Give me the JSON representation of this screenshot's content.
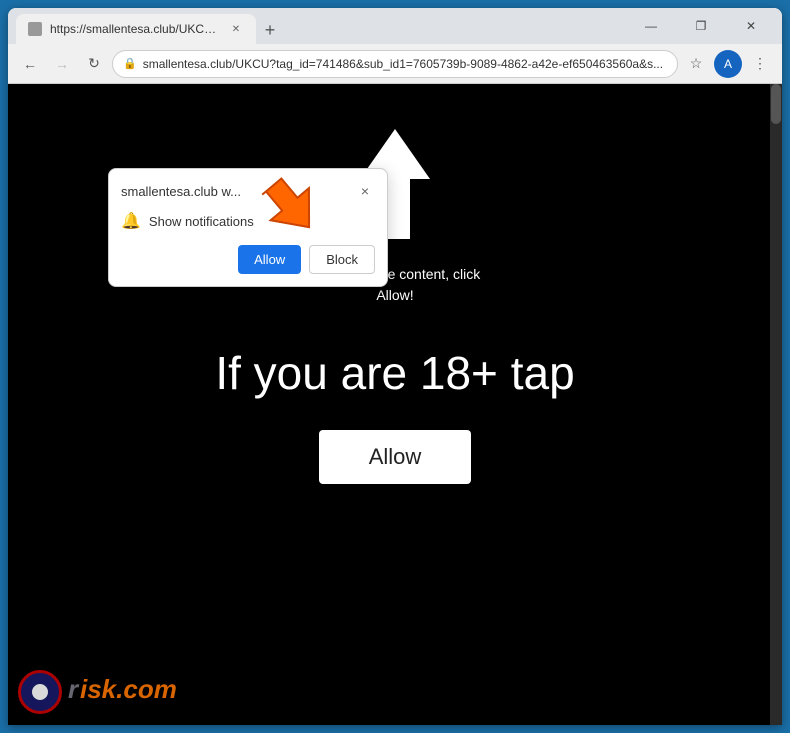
{
  "browser": {
    "url": "https://smallentesa.club/UKCU?tag_id=741486&sub_id1=7605739b-9089-4862-a42e-ef650463560a&s...",
    "url_short": "smallentesa.club/UKCU?tag_id=741486&sub_id1=7605739b-9089-4862-a42e-ef650463560a&s...",
    "tab_label": "https://smallentesa.club/UKCU?t...",
    "favicon_alt": "page icon"
  },
  "window_controls": {
    "minimize": "—",
    "maximize": "❐",
    "close": "✕"
  },
  "nav": {
    "back": "←",
    "forward": "→",
    "refresh": "↻",
    "star": "☆",
    "menu": "⋮"
  },
  "notification_popup": {
    "site": "smallentesa.club w...",
    "close": "×",
    "notification_text": "Show notifications",
    "allow_label": "Allow",
    "block_label": "Block"
  },
  "page": {
    "small_text_line1": "To access the content, click",
    "small_text_line2": "Allow!",
    "large_text": "If you are 18+ tap",
    "allow_button_label": "Allow"
  },
  "watermark": {
    "text_before": "r",
    "text_colored": "isk.com"
  }
}
